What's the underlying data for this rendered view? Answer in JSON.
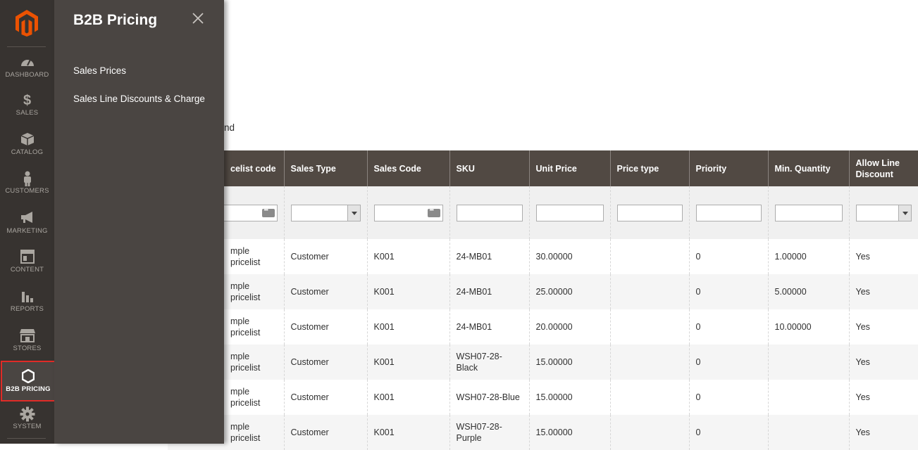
{
  "sidebar": {
    "items": [
      {
        "label": "DASHBOARD",
        "icon": "dashboard-icon"
      },
      {
        "label": "SALES",
        "icon": "dollar-icon"
      },
      {
        "label": "CATALOG",
        "icon": "box-icon"
      },
      {
        "label": "CUSTOMERS",
        "icon": "person-icon"
      },
      {
        "label": "MARKETING",
        "icon": "megaphone-icon"
      },
      {
        "label": "CONTENT",
        "icon": "layout-icon"
      },
      {
        "label": "REPORTS",
        "icon": "bar-chart-icon"
      },
      {
        "label": "STORES",
        "icon": "store-icon"
      },
      {
        "label": "B2B PRICING",
        "icon": "hexagon-icon"
      },
      {
        "label": "SYSTEM",
        "icon": "gear-icon"
      }
    ],
    "active_color": "#e02b27"
  },
  "submenu": {
    "title": "B2B Pricing",
    "links": [
      "Sales Prices",
      "Sales Line Discounts & Charge"
    ]
  },
  "content": {
    "partial_text": "nd"
  },
  "grid": {
    "headers": [
      "celist code",
      "Sales Type",
      "Sales Code",
      "SKU",
      "Unit Price",
      "Price type",
      "Priority",
      "Min. Quantity",
      "Allow Line Discount"
    ],
    "rows": [
      [
        "mple pricelist",
        "Customer",
        "K001",
        "24-MB01",
        "30.00000",
        "",
        "0",
        "1.00000",
        "Yes"
      ],
      [
        "mple pricelist",
        "Customer",
        "K001",
        "24-MB01",
        "25.00000",
        "",
        "0",
        "5.00000",
        "Yes"
      ],
      [
        "mple pricelist",
        "Customer",
        "K001",
        "24-MB01",
        "20.00000",
        "",
        "0",
        "10.00000",
        "Yes"
      ],
      [
        "mple pricelist",
        "Customer",
        "K001",
        "WSH07-28-Black",
        "15.00000",
        "",
        "0",
        "",
        "Yes"
      ],
      [
        "mple pricelist",
        "Customer",
        "K001",
        "WSH07-28-Blue",
        "15.00000",
        "",
        "0",
        "",
        "Yes"
      ],
      [
        "mple pricelist",
        "Customer",
        "K001",
        "WSH07-28-Purple",
        "15.00000",
        "",
        "0",
        "",
        "Yes"
      ]
    ]
  },
  "colors": {
    "nav_bg": "#373330",
    "submenu_bg": "#4a4542",
    "header_bg": "#514943",
    "logo": "#eb5202"
  }
}
